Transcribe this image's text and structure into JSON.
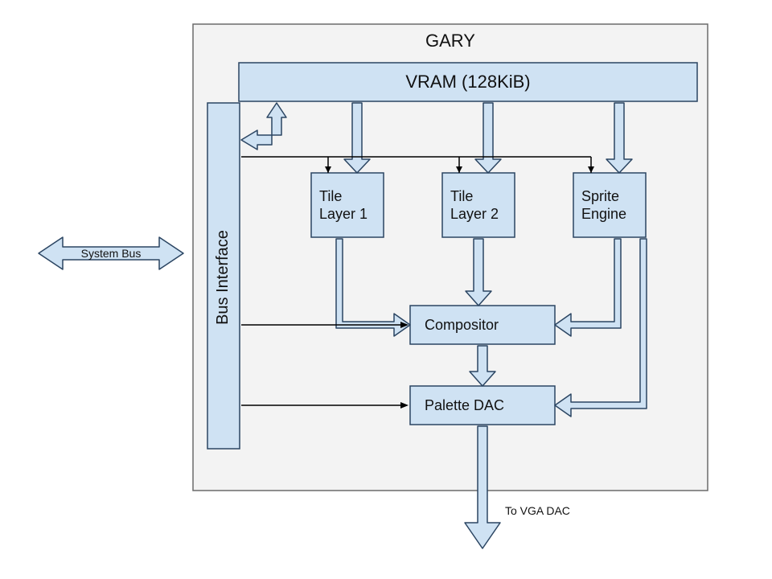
{
  "diagram": {
    "title": "GARY",
    "blocks": {
      "vram": "VRAM (128KiB)",
      "bus_if": "Bus Interface",
      "tile1a": "Tile",
      "tile1b": "Layer 1",
      "tile2a": "Tile",
      "tile2b": "Layer 2",
      "spritea": "Sprite",
      "spriteb": "Engine",
      "compositor": "Compositor",
      "palette": "Palette DAC"
    },
    "ext": {
      "system_bus": "System Bus",
      "to_vga": "To VGA DAC"
    }
  }
}
